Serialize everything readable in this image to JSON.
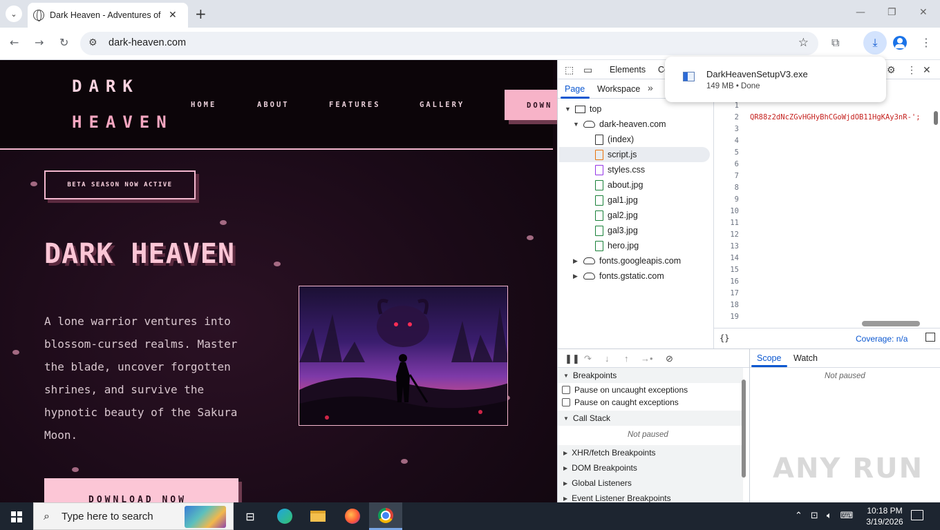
{
  "browser": {
    "tab_title": "Dark Heaven - Adventures of a",
    "url": "dark-heaven.com",
    "icons": [
      "tab-search-icon",
      "globe-icon",
      "close-icon",
      "plus-icon",
      "back-icon",
      "forward-icon",
      "reload-icon",
      "site-info-icon",
      "star-icon",
      "extensions-icon",
      "download-icon",
      "profile-icon",
      "menu-icon"
    ]
  },
  "download": {
    "filename": "DarkHeavenSetupV3.exe",
    "status": "149 MB • Done"
  },
  "site": {
    "logo_line1": "DARK",
    "logo_line2": "HEAVEN",
    "nav": [
      "HOME",
      "ABOUT",
      "FEATURES",
      "GALLERY"
    ],
    "nav_download": "DOWN",
    "badge": "BETA SEASON NOW ACTIVE",
    "hero_title": "DARK HEAVEN",
    "hero_desc": "A lone warrior ventures into blossom-cursed realms. Master the blade, uncover forgotten shrines, and survive the hypnotic beauty of the Sakura Moon.",
    "hero_cta": "DOWNLOAD NOW",
    "colors": {
      "accent_pink": "#f7b3c8",
      "bg_dark": "#1a0a17"
    }
  },
  "devtools": {
    "tabs": {
      "elements": "Elements",
      "console_cut": "Co"
    },
    "sidebar_tabs": {
      "page": "Page",
      "workspace": "Workspace"
    },
    "tree": {
      "top": "top",
      "domain": "dark-heaven.com",
      "files": [
        {
          "name": "(index)",
          "kind": "doc"
        },
        {
          "name": "script.js",
          "kind": "js"
        },
        {
          "name": "styles.css",
          "kind": "css"
        },
        {
          "name": "about.jpg",
          "kind": "img"
        },
        {
          "name": "gal1.jpg",
          "kind": "img"
        },
        {
          "name": "gal2.jpg",
          "kind": "img"
        },
        {
          "name": "gal3.jpg",
          "kind": "img"
        },
        {
          "name": "hero.jpg",
          "kind": "img"
        }
      ],
      "other_domains": [
        "fonts.googleapis.com",
        "fonts.gstatic.com"
      ]
    },
    "editor": {
      "line_numbers": [
        "1",
        "2",
        "3",
        "4",
        "5",
        "6",
        "7",
        "8",
        "9",
        "10",
        "11",
        "12",
        "13",
        "14",
        "15",
        "16",
        "17",
        "18",
        "19"
      ],
      "code_line2": "QR88z2dNcZGvHGHyBhCGoWjdOB11HgKAy3nR-';"
    },
    "coverage": "Coverage: n/a",
    "pretty_print": "{}",
    "debugger": {
      "breakpoints": "Breakpoints",
      "pause_uncaught": "Pause on uncaught exceptions",
      "pause_caught": "Pause on caught exceptions",
      "call_stack": "Call Stack",
      "not_paused": "Not paused",
      "xhr": "XHR/fetch Breakpoints",
      "dom": "DOM Breakpoints",
      "global": "Global Listeners",
      "event": "Event Listener Breakpoints",
      "scope": "Scope",
      "watch": "Watch",
      "scope_not_paused": "Not paused"
    }
  },
  "taskbar": {
    "search_placeholder": "Type here to search",
    "time": "10:18 PM",
    "date": "3/19/2026"
  },
  "watermark": "ANY RUN"
}
